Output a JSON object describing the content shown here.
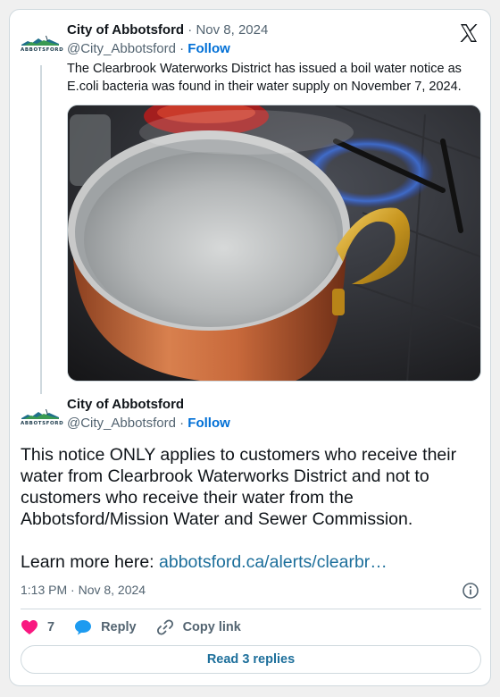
{
  "platform": {
    "logo_icon": "x-logo-icon"
  },
  "first_tweet": {
    "display_name": "City of Abbotsford",
    "separator": " · ",
    "date": "Nov 8, 2024",
    "handle": "@City_Abbotsford",
    "dot": " · ",
    "follow_label": "Follow",
    "avatar_text": "ABBOTSFORD",
    "text_line1": "The Clearbrook Waterworks District has issued a boil water notice as",
    "text_line2": "E.coli bacteria was found in their water supply on November 7, 2024.",
    "media_icon": "boiling-pot-photo"
  },
  "second_tweet": {
    "display_name": "City of Abbotsford",
    "handle": "@City_Abbotsford",
    "dot": " · ",
    "follow_label": "Follow",
    "avatar_text": "ABBOTSFORD",
    "paragraph1": "This notice ONLY applies to customers who receive their water from Clearbrook Waterworks District and not to customers who receive their water from the Abbotsford/Mission Water and Sewer Commission.",
    "learn_more_prefix": "Learn more here: ",
    "learn_more_link": "abbotsford.ca/alerts/clearbr…",
    "timestamp": "1:13 PM · Nov 8, 2024"
  },
  "actions": {
    "like_count": "7",
    "reply_label": "Reply",
    "copy_link_label": "Copy link",
    "read_replies_label": "Read 3 replies"
  },
  "colors": {
    "link": "#1d6f9b",
    "follow": "#006fd6",
    "like": "#f91880",
    "reply_bubble": "#1d9bf0"
  }
}
